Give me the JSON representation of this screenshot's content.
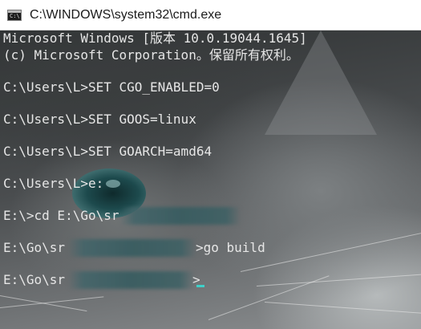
{
  "window": {
    "title": "C:\\WINDOWS\\system32\\cmd.exe",
    "icon": "cmd-icon",
    "icon_prompt": "C:\\"
  },
  "console": {
    "lines": [
      "Microsoft Windows [版本 10.0.19044.1645]",
      "(c) Microsoft Corporation。保留所有权利。",
      "",
      "C:\\Users\\L>SET CGO_ENABLED=0",
      "",
      "C:\\Users\\L>SET GOOS=linux",
      "",
      "C:\\Users\\L>SET GOARCH=amd64",
      "",
      "C:\\Users\\L>e:",
      "",
      "E:\\>cd E:\\Go\\sr",
      "",
      "E:\\Go\\sr",
      "",
      "E:\\Go\\sr"
    ],
    "build_command": ">go build",
    "final_prompt_end": ">",
    "cursor_color": "#3fd0c9",
    "text_color": "#e6e6e6"
  }
}
